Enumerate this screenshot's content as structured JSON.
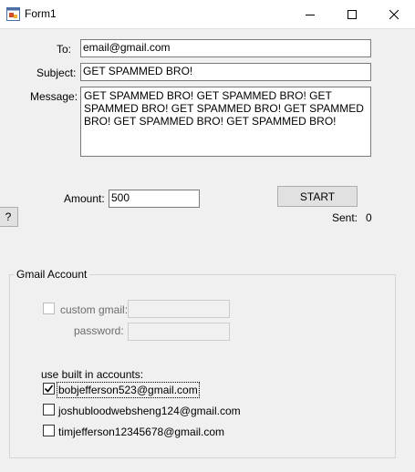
{
  "window": {
    "title": "Form1",
    "icon": "app-form-icon"
  },
  "form": {
    "to_label": "To:",
    "to_value": "email@gmail.com",
    "subject_label": "Subject:",
    "subject_value": "GET SPAMMED BRO!",
    "message_label": "Message:",
    "message_value": "GET SPAMMED BRO! GET SPAMMED BRO! GET SPAMMED BRO! GET SPAMMED BRO! GET SPAMMED BRO! GET SPAMMED BRO! GET SPAMMED BRO!",
    "amount_label": "Amount:",
    "amount_value": "500",
    "start_label": "START",
    "help_label": "?",
    "sent_label": "Sent:",
    "sent_value": "0"
  },
  "gmail_account": {
    "group_title": "Gmail Account",
    "custom_gmail_label": "custom gmail:",
    "custom_gmail_value": "",
    "password_label": "password:",
    "password_value": "",
    "builtin_label": "use built in accounts:",
    "accounts": [
      {
        "email": "bobjefferson523@gmail.com",
        "checked": true
      },
      {
        "email": "joshubloodwebsheng124@gmail.com",
        "checked": false
      },
      {
        "email": "timjefferson12345678@gmail.com",
        "checked": false
      }
    ]
  }
}
